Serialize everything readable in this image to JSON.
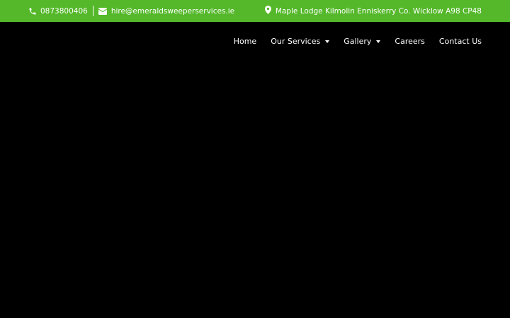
{
  "colors": {
    "topbar_bg": "#54b82a",
    "page_bg": "#000000",
    "text": "#ffffff"
  },
  "topbar": {
    "phone": "0873800406",
    "phone_icon": "phone-icon",
    "email": "hire@emeraldsweeperservices.ie",
    "email_icon": "envelope-icon",
    "address": "Maple Lodge Kilmolin Enniskerry Co. Wicklow A98 CP48",
    "address_icon": "map-pin-icon"
  },
  "nav": {
    "items": [
      {
        "label": "Home",
        "dropdown": false
      },
      {
        "label": "Our Services",
        "dropdown": true
      },
      {
        "label": "Gallery",
        "dropdown": true
      },
      {
        "label": "Careers",
        "dropdown": false
      },
      {
        "label": "Contact Us",
        "dropdown": false
      }
    ]
  }
}
